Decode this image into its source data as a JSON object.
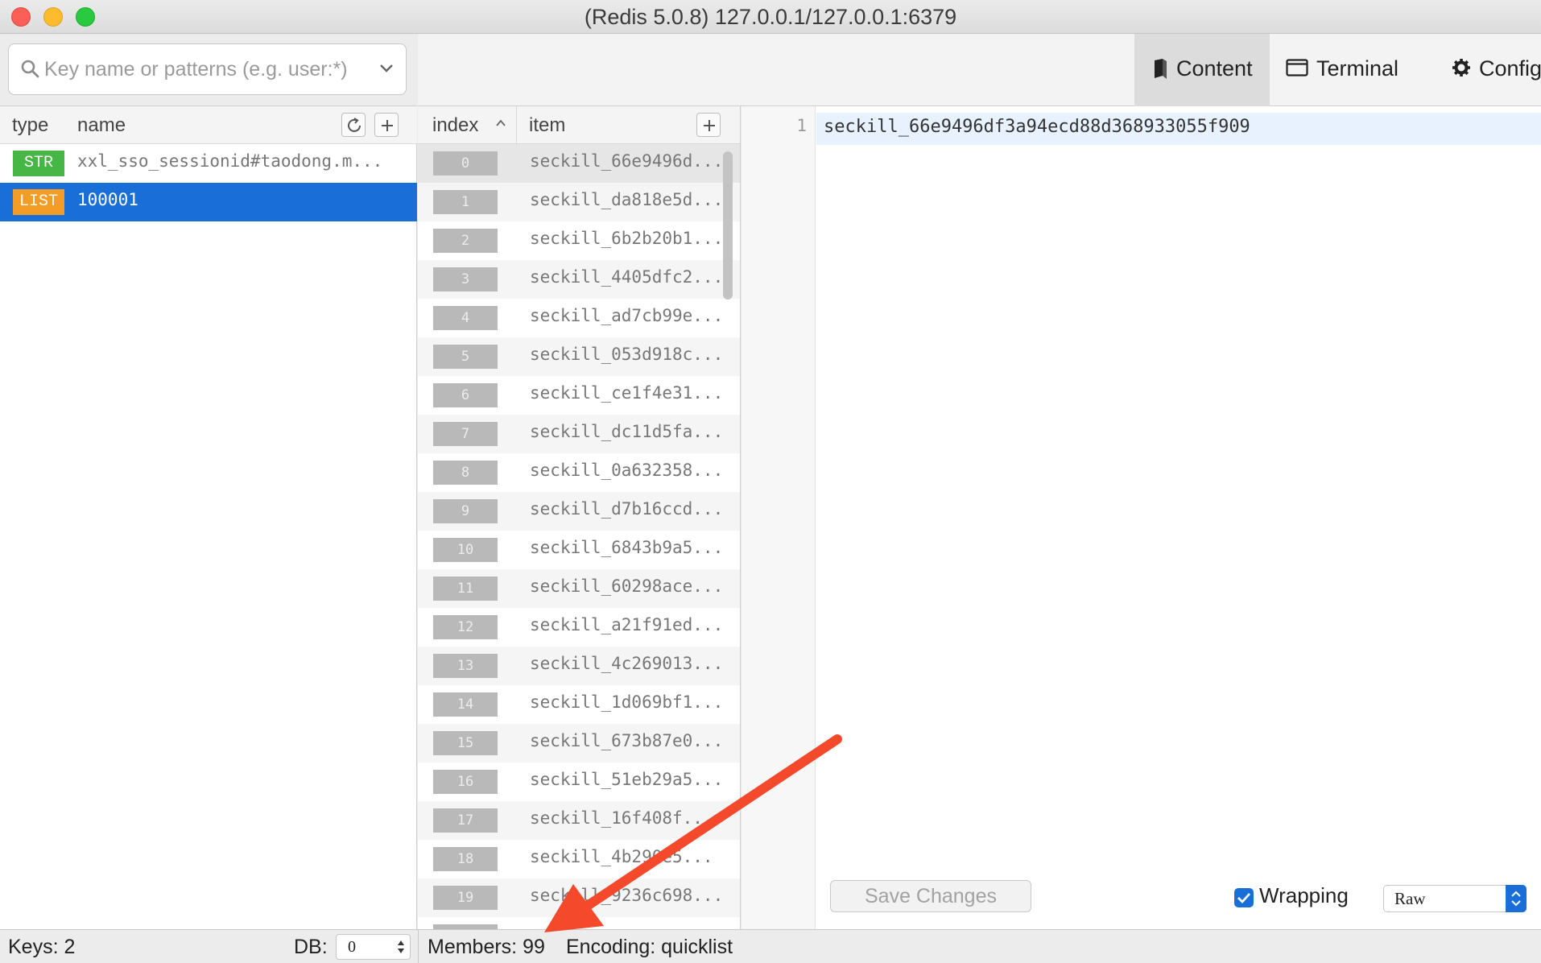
{
  "window": {
    "title": "(Redis 5.0.8) 127.0.0.1/127.0.0.1:6379"
  },
  "search": {
    "placeholder": "Key name or patterns (e.g. user:*)",
    "value": ""
  },
  "key_list": {
    "headers": {
      "type": "type",
      "name": "name"
    },
    "keys": [
      {
        "type": "STR",
        "name": "xxl_sso_sessionid#taodong.m..."
      },
      {
        "type": "LIST",
        "name": "100001",
        "selected": true
      }
    ]
  },
  "tabs": [
    {
      "label": "Content",
      "icon": "content-icon",
      "active": true
    },
    {
      "label": "Terminal",
      "icon": "terminal-icon"
    },
    {
      "label": "Config",
      "icon": "gear-icon"
    }
  ],
  "list_view": {
    "headers": {
      "index": "index",
      "item": "item"
    },
    "rows": [
      {
        "index": "0",
        "item": "seckill_66e9496d..."
      },
      {
        "index": "1",
        "item": "seckill_da818e5d..."
      },
      {
        "index": "2",
        "item": "seckill_6b2b20b1..."
      },
      {
        "index": "3",
        "item": "seckill_4405dfc2..."
      },
      {
        "index": "4",
        "item": "seckill_ad7cb99e..."
      },
      {
        "index": "5",
        "item": "seckill_053d918c..."
      },
      {
        "index": "6",
        "item": "seckill_ce1f4e31..."
      },
      {
        "index": "7",
        "item": "seckill_dc11d5fa..."
      },
      {
        "index": "8",
        "item": "seckill_0a632358..."
      },
      {
        "index": "9",
        "item": "seckill_d7b16ccd..."
      },
      {
        "index": "10",
        "item": "seckill_6843b9a5..."
      },
      {
        "index": "11",
        "item": "seckill_60298ace..."
      },
      {
        "index": "12",
        "item": "seckill_a21f91ed..."
      },
      {
        "index": "13",
        "item": "seckill_4c269013..."
      },
      {
        "index": "14",
        "item": "seckill_1d069bf1..."
      },
      {
        "index": "15",
        "item": "seckill_673b87e0..."
      },
      {
        "index": "16",
        "item": "seckill_51eb29a5..."
      },
      {
        "index": "17",
        "item": "seckill_16f408f..."
      },
      {
        "index": "18",
        "item": "seckill_4b290e5..."
      },
      {
        "index": "19",
        "item": "seckill_9236c698..."
      },
      {
        "index": "",
        "item": ""
      }
    ]
  },
  "editor": {
    "line_number": "1",
    "text": "seckill_66e9496df3a94ecd88d368933055f909",
    "save_label": "Save Changes",
    "wrapping_label": "Wrapping",
    "wrapping_checked": true,
    "format": "Raw"
  },
  "status": {
    "keys": "Keys: 2",
    "db_label": "DB:",
    "db_value": "0",
    "members": "Members: 99",
    "encoding": "Encoding: quicklist"
  },
  "colors": {
    "accent": "#1a6ed8",
    "str_badge": "#46b744",
    "list_badge": "#f39d26",
    "annotation_arrow": "#f4492a"
  }
}
